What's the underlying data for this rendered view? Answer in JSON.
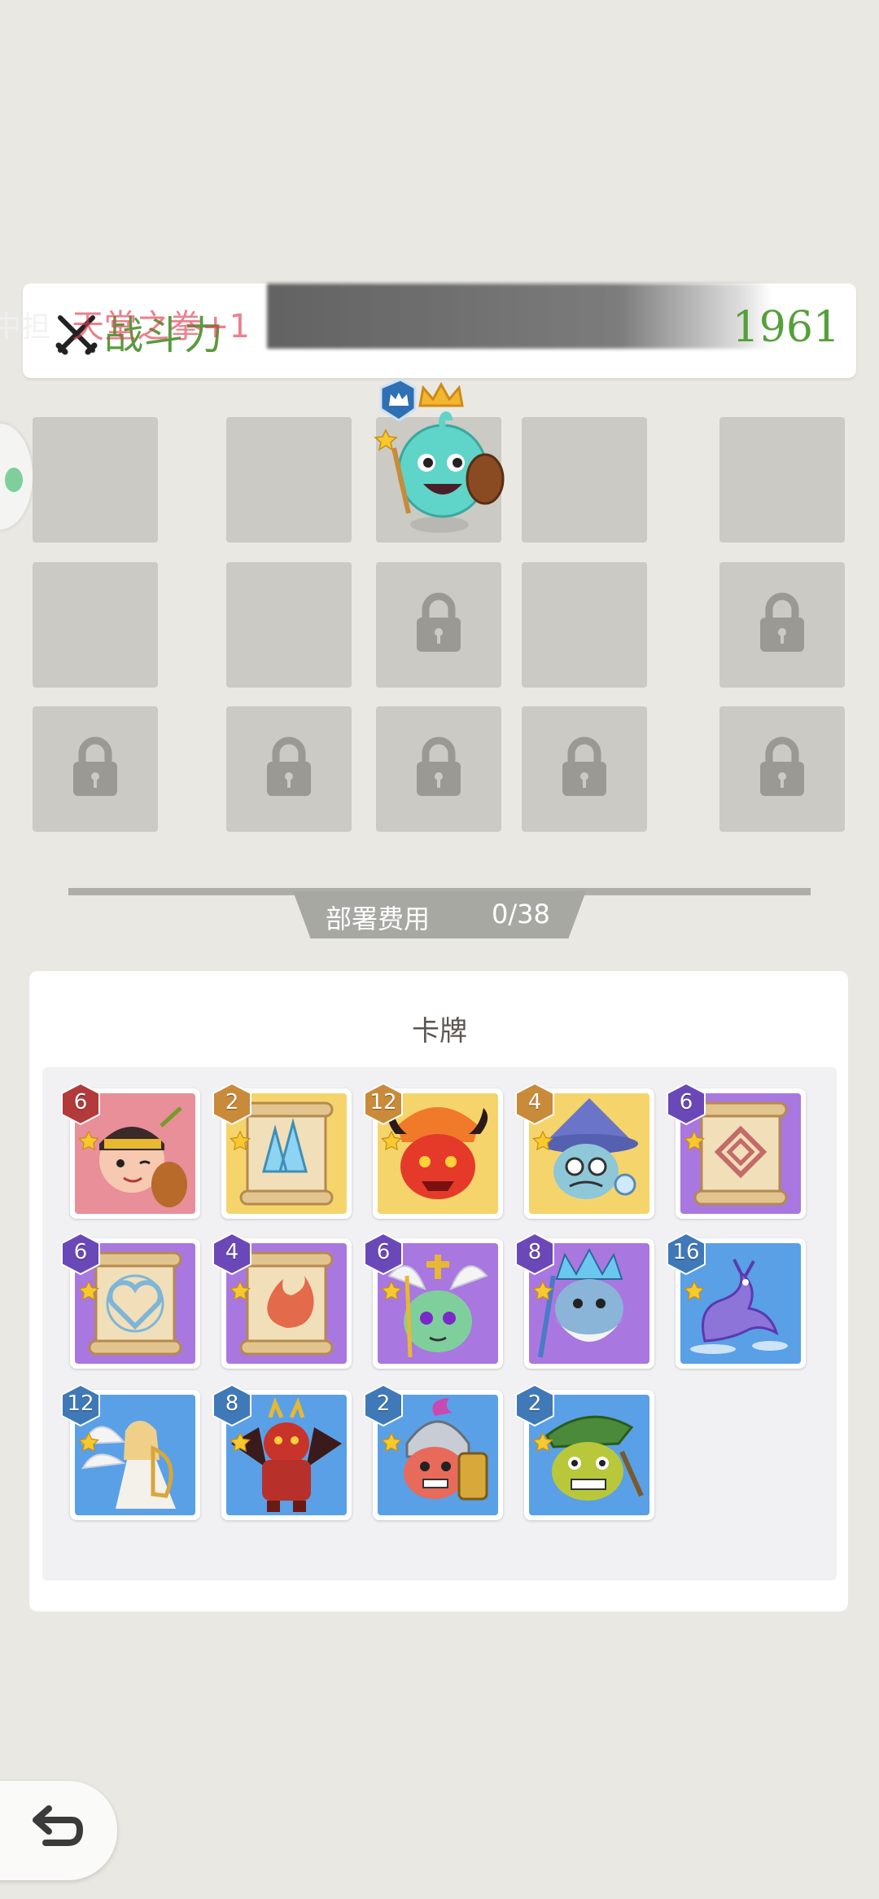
{
  "power": {
    "label": "战斗力",
    "overlay_text": "天堂之拳+1",
    "left_fragment": "中担",
    "value": "1961",
    "icon": "crossed-swords-icon"
  },
  "deployment_grid": {
    "rows": 3,
    "cols": 5,
    "cells": [
      [
        "empty",
        "empty",
        "hero",
        "empty",
        "empty"
      ],
      [
        "empty",
        "empty",
        "locked",
        "empty",
        "locked"
      ],
      [
        "locked",
        "locked",
        "locked",
        "locked",
        "locked"
      ]
    ],
    "hero": {
      "badge_icon": "crown-shield-icon",
      "top_icon": "gold-crown-icon",
      "star_icon": "star-icon"
    }
  },
  "deployment_cost": {
    "label": "部署费用",
    "value": "0/38"
  },
  "cards": {
    "title": "卡牌",
    "items": [
      {
        "cost": "6",
        "badge": "red",
        "bg": "pink",
        "art": "bard-hero"
      },
      {
        "cost": "2",
        "badge": "orange",
        "bg": "yellow",
        "art": "crystal-scroll"
      },
      {
        "cost": "12",
        "badge": "orange",
        "bg": "yellow",
        "art": "fire-demon"
      },
      {
        "cost": "4",
        "badge": "orange",
        "bg": "yellow",
        "art": "wizard-hero"
      },
      {
        "cost": "6",
        "badge": "purple",
        "bg": "purple",
        "art": "rune-scroll"
      },
      {
        "cost": "6",
        "badge": "purple",
        "bg": "purple",
        "art": "heart-scroll"
      },
      {
        "cost": "4",
        "badge": "purple",
        "bg": "purple",
        "art": "fire-scroll"
      },
      {
        "cost": "6",
        "badge": "purple",
        "bg": "purple",
        "art": "winged-priest"
      },
      {
        "cost": "8",
        "badge": "purple",
        "bg": "purple",
        "art": "frost-king"
      },
      {
        "cost": "16",
        "badge": "blue",
        "bg": "blue",
        "art": "purple-dragon"
      },
      {
        "cost": "12",
        "badge": "blue",
        "bg": "blue",
        "art": "harp-angel"
      },
      {
        "cost": "8",
        "badge": "blue",
        "bg": "blue",
        "art": "lava-demon"
      },
      {
        "cost": "2",
        "badge": "blue",
        "bg": "blue",
        "art": "helmet-warrior"
      },
      {
        "cost": "2",
        "badge": "blue",
        "bg": "blue",
        "art": "goblin-ranger"
      }
    ]
  },
  "back_button": {
    "icon": "undo-arrow-icon"
  },
  "colors": {
    "power_green": "#55a03a",
    "badge_red": "#b23a3a",
    "badge_orange": "#c98a3a",
    "badge_purple": "#6a48b8",
    "badge_blue": "#3f79b8",
    "bg_pink": "#e88f9a",
    "bg_yellow": "#f6d46c",
    "bg_purple": "#a977e0",
    "bg_blue": "#5aa0e6"
  }
}
